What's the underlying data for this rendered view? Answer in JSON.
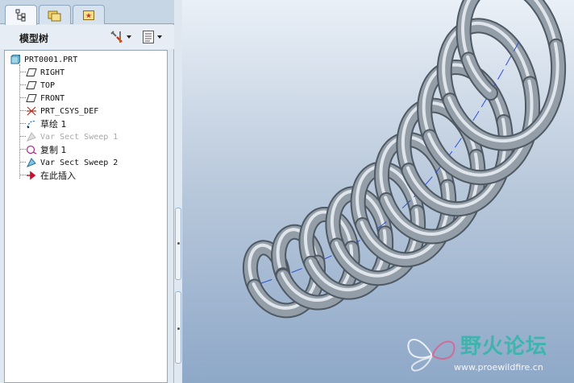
{
  "panel": {
    "title": "模型树",
    "tabs": [
      {
        "name": "model-tree-tab",
        "icon": "model-tree-icon",
        "active": true
      },
      {
        "name": "folder-browser-tab",
        "icon": "folder-icon",
        "active": false
      },
      {
        "name": "favorites-tab",
        "icon": "favorites-icon",
        "active": false
      }
    ],
    "tools": [
      {
        "name": "settings-tool-button",
        "icon": "tools-icon"
      },
      {
        "name": "show-tree-button",
        "icon": "list-icon"
      }
    ]
  },
  "tree": {
    "root": "PRT0001.PRT",
    "items": [
      {
        "label": "RIGHT",
        "icon": "datum-plane-icon",
        "suppressed": false
      },
      {
        "label": "TOP",
        "icon": "datum-plane-icon",
        "suppressed": false
      },
      {
        "label": "FRONT",
        "icon": "datum-plane-icon",
        "suppressed": false
      },
      {
        "label": "PRT_CSYS_DEF",
        "icon": "coordinate-system-icon",
        "suppressed": false
      },
      {
        "label": "草绘 1",
        "icon": "sketch-icon",
        "suppressed": false
      },
      {
        "label": "Var Sect Sweep 1",
        "icon": "sweep-icon",
        "suppressed": true
      },
      {
        "label": "复制 1",
        "icon": "copy-icon",
        "suppressed": false
      },
      {
        "label": "Var Sect Sweep 2",
        "icon": "sweep-icon",
        "suppressed": false
      },
      {
        "label": "在此插入",
        "icon": "insert-arrow-icon",
        "suppressed": false
      }
    ]
  },
  "viewport": {
    "model": "helical-spring-model",
    "watermark": {
      "title": "野火论坛",
      "url": "www.proewildfire.cn"
    }
  },
  "colors": {
    "panel_bg": "#dfe8f1",
    "viewport_top": "#eaf0f7",
    "viewport_bottom": "#8ea8c8",
    "spring": "#8a959f",
    "axis": "#2a4fd8",
    "watermark": "#36b5a9"
  }
}
